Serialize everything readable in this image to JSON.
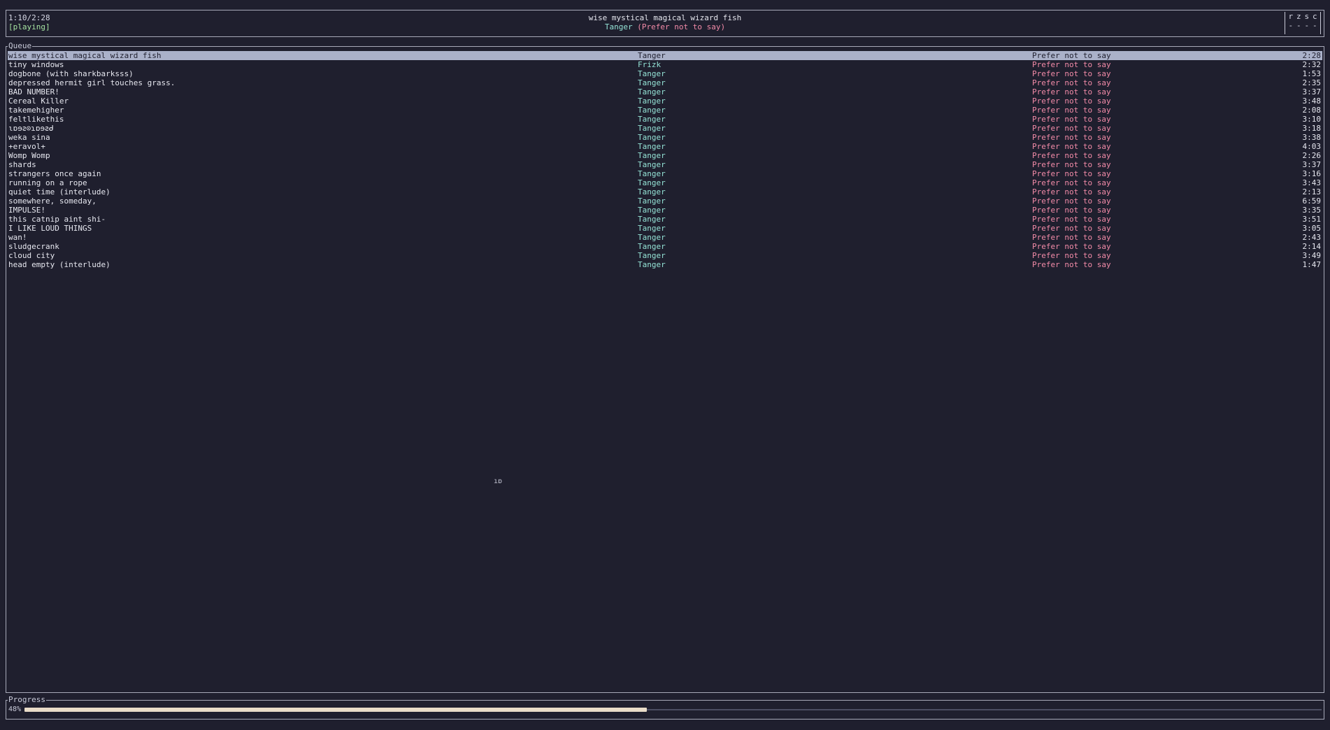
{
  "header": {
    "elapsed": "1:10/2:28",
    "status": "[playing]",
    "now_title": "wise mystical magical wizard fish",
    "now_artist": "Tanger",
    "now_album": "(Prefer not to say)",
    "flags": [
      "r",
      "z",
      "s",
      "c"
    ],
    "flag_states": [
      "-",
      "-",
      "-",
      "-"
    ]
  },
  "queue": {
    "title": "Queue",
    "selected_index": 0,
    "rows": [
      {
        "title": "wise mystical magical wizard fish",
        "artist": "Tanger",
        "album": "Prefer not to say",
        "duration": "2:28"
      },
      {
        "title": "tiny windows",
        "artist": "Frizk",
        "album": "Prefer not to say",
        "duration": "2:32"
      },
      {
        "title": "dogbone (with sharkbarksss)",
        "artist": "Tanger",
        "album": "Prefer not to say",
        "duration": "1:53"
      },
      {
        "title": "depressed hermit girl touches grass.",
        "artist": "Tanger",
        "album": "Prefer not to say",
        "duration": "2:35"
      },
      {
        "title": "BAD NUMBER!",
        "artist": "Tanger",
        "album": "Prefer not to say",
        "duration": "3:37"
      },
      {
        "title": "Cereal Killer",
        "artist": "Tanger",
        "album": "Prefer not to say",
        "duration": "3:48"
      },
      {
        "title": "takemehigher",
        "artist": "Tanger",
        "album": "Prefer not to say",
        "duration": "2:08"
      },
      {
        "title": "feltlikethis",
        "artist": "Tanger",
        "album": "Prefer not to say",
        "duration": "3:10"
      },
      {
        "title": "ɩɒɘꙅ⊙ɿɒɘꙅᑯ",
        "artist": "Tanger",
        "album": "Prefer not to say",
        "duration": "3:18"
      },
      {
        "title": "weka sina",
        "artist": "Tanger",
        "album": "Prefer not to say",
        "duration": "3:38"
      },
      {
        "title": "+eravol+",
        "artist": "Tanger",
        "album": "Prefer not to say",
        "duration": "4:03"
      },
      {
        "title": "Womp Womp",
        "artist": "Tanger",
        "album": "Prefer not to say",
        "duration": "2:26"
      },
      {
        "title": "shards",
        "artist": "Tanger",
        "album": "Prefer not to say",
        "duration": "3:37"
      },
      {
        "title": "strangers once again",
        "artist": "Tanger",
        "album": "Prefer not to say",
        "duration": "3:16"
      },
      {
        "title": "running on a rope",
        "artist": "Tanger",
        "album": "Prefer not to say",
        "duration": "3:43"
      },
      {
        "title": "quiet time (interlude)",
        "artist": "Tanger",
        "album": "Prefer not to say",
        "duration": "2:13"
      },
      {
        "title": "somewhere, someday,",
        "artist": "Tanger",
        "album": "Prefer not to say",
        "duration": "6:59"
      },
      {
        "title": "IMPULSE!",
        "artist": "Tanger",
        "album": "Prefer not to say",
        "duration": "3:35"
      },
      {
        "title": "this catnip aint shi-",
        "artist": "Tanger",
        "album": "Prefer not to say",
        "duration": "3:51"
      },
      {
        "title": "I LIKE LOUD THINGS",
        "artist": "Tanger",
        "album": "Prefer not to say",
        "duration": "3:05"
      },
      {
        "title": "wan!",
        "artist": "Tanger",
        "album": "Prefer not to say",
        "duration": "2:43"
      },
      {
        "title": "sludgecrank",
        "artist": "Tanger",
        "album": "Prefer not to say",
        "duration": "2:14"
      },
      {
        "title": "cloud city",
        "artist": "Tanger",
        "album": "Prefer not to say",
        "duration": "3:49"
      },
      {
        "title": "head empty (interlude)",
        "artist": "Tanger",
        "album": "Prefer not to say",
        "duration": "1:47"
      }
    ],
    "stray_glyph": "ıɒ"
  },
  "progress": {
    "title": "Progress",
    "label": "48%",
    "fraction": 0.48
  },
  "colors": {
    "background": "#1f1f2e",
    "artist": "#94e2d5",
    "album": "#f38ba8",
    "status": "#a6e3a1",
    "selection": "#aab1c9",
    "progress_fill": "#e9dcc8"
  }
}
